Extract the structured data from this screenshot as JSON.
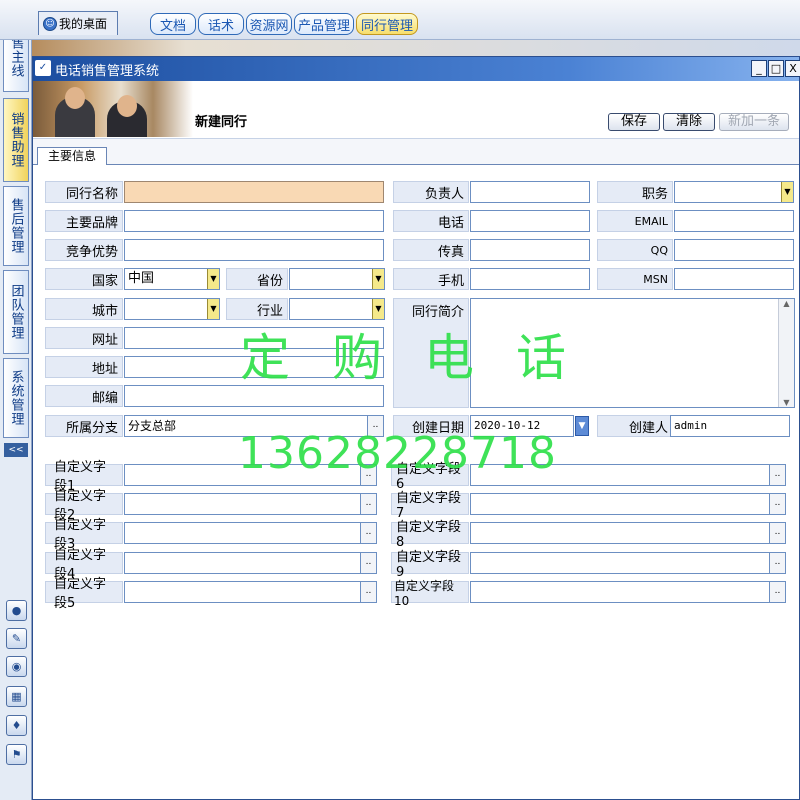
{
  "top_tabs": {
    "desktop": "我的桌面",
    "tabs": [
      "文档",
      "话术",
      "资源网",
      "产品管理",
      "同行管理"
    ],
    "active_index": 4
  },
  "sidebar": {
    "items": [
      "销售主线",
      "销售助理",
      "售后管理",
      "团队管理",
      "系统管理"
    ],
    "active_index": 1,
    "collapse": "<<",
    "icons": [
      "user-icon",
      "edit-icon",
      "globe-icon",
      "calendar-icon",
      "share-icon",
      "badge-icon"
    ]
  },
  "window": {
    "title": "电话销售管理系统",
    "controls": [
      "_",
      "□",
      "X"
    ]
  },
  "header": {
    "page_title": "新建同行",
    "save": "保存",
    "clear": "清除",
    "add_new": "新加一条"
  },
  "tab": {
    "main": "主要信息"
  },
  "form": {
    "name_label": "同行名称",
    "brand_label": "主要品牌",
    "advantage_label": "竞争优势",
    "country_label": "国家",
    "country_value": "中国",
    "province_label": "省份",
    "city_label": "城市",
    "industry_label": "行业",
    "website_label": "网址",
    "address_label": "地址",
    "zip_label": "邮编",
    "branch_label": "所属分支",
    "branch_value": "分支总部",
    "owner_label": "负责人",
    "phone_label": "电话",
    "fax_label": "传真",
    "mobile_label": "手机",
    "intro_label": "同行简介",
    "created_date_label": "创建日期",
    "created_date_value": "2020-10-12",
    "position_label": "职务",
    "email_label": "EMAIL",
    "qq_label": "QQ",
    "msn_label": "MSN",
    "creator_label": "创建人",
    "creator_value": "admin",
    "custom_left": [
      "自定义字段1",
      "自定义字段2",
      "自定义字段3",
      "自定义字段4",
      "自定义字段5"
    ],
    "custom_right": [
      "自定义字段6",
      "自定义字段7",
      "自定义字段8",
      "自定义字段9",
      "自定义字段10"
    ],
    "picker_button": ".."
  },
  "watermark": {
    "line1": "定购电话",
    "line2": "13628228718"
  },
  "colors": {
    "accent": "#1c4ea0",
    "highlight": "#f9d9b4",
    "watermark": "#2fe04a"
  }
}
